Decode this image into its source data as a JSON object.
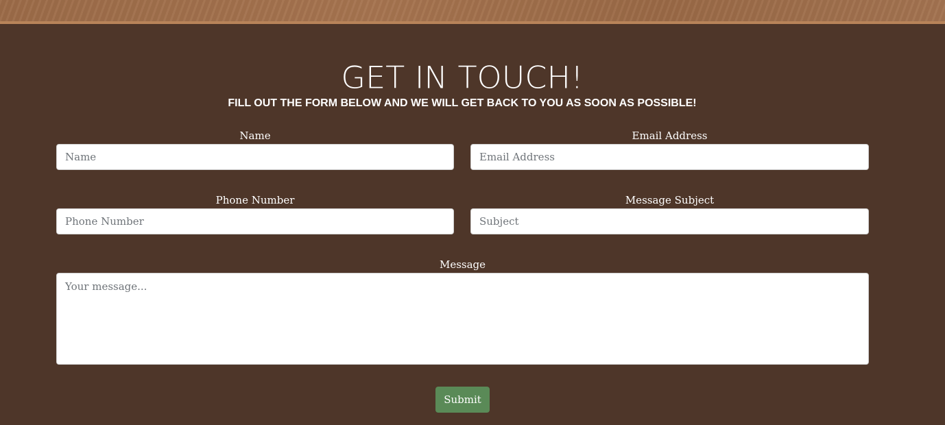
{
  "section": {
    "title": "GET IN TOUCH!",
    "subtitle": "FILL OUT THE FORM BELOW AND WE WILL GET BACK TO YOU AS SOON AS POSSIBLE!"
  },
  "form": {
    "name": {
      "label": "Name",
      "placeholder": "Name",
      "value": ""
    },
    "email": {
      "label": "Email Address",
      "placeholder": "Email Address",
      "value": ""
    },
    "phone": {
      "label": "Phone Number",
      "placeholder": "Phone Number",
      "value": ""
    },
    "subject": {
      "label": "Message Subject",
      "placeholder": "Subject",
      "value": ""
    },
    "message": {
      "label": "Message",
      "placeholder": "Your message...",
      "value": ""
    },
    "submit_label": "Submit"
  },
  "colors": {
    "background": "#4e3629",
    "banner": "#9c6b48",
    "submit": "#5a8a57",
    "text": "#ffffff"
  }
}
